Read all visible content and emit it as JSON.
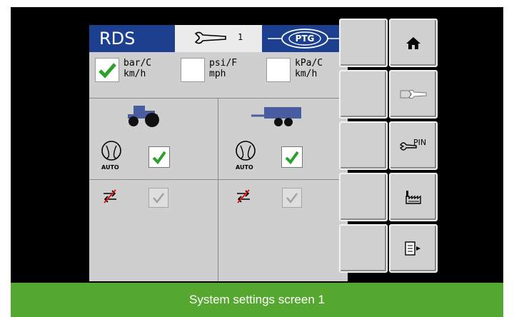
{
  "header": {
    "title": "RDS",
    "settings_number": "1",
    "brand_logo": "PTG"
  },
  "units": [
    {
      "line1": "bar/C",
      "line2": "km/h",
      "checked": true
    },
    {
      "line1": "psi/F",
      "line2": "mph",
      "checked": false
    },
    {
      "line1": "kPa/C",
      "line2": "km/h",
      "checked": false
    }
  ],
  "panels": {
    "tractor": {
      "icon": "tractor-icon",
      "auto_label": "AUTO",
      "auto_checked": true,
      "pressure_checked": true
    },
    "trailer": {
      "icon": "trailer-icon",
      "auto_label": "AUTO",
      "auto_checked": true,
      "pressure_checked": true
    }
  },
  "sidebar": {
    "left_column": [
      "blank-button",
      "blank-button",
      "blank-button",
      "blank-button",
      "blank-button"
    ],
    "right_column": [
      "home-icon",
      "settings-wrench-icon",
      "wrench-pin-icon",
      "factory-icon",
      "exit-form-icon"
    ],
    "pin_label": "PIN"
  },
  "colors": {
    "header_blue": "#1d3f8f",
    "caption_green": "#56a72f",
    "check_green": "#2aa12a"
  },
  "caption": "System settings screen 1"
}
